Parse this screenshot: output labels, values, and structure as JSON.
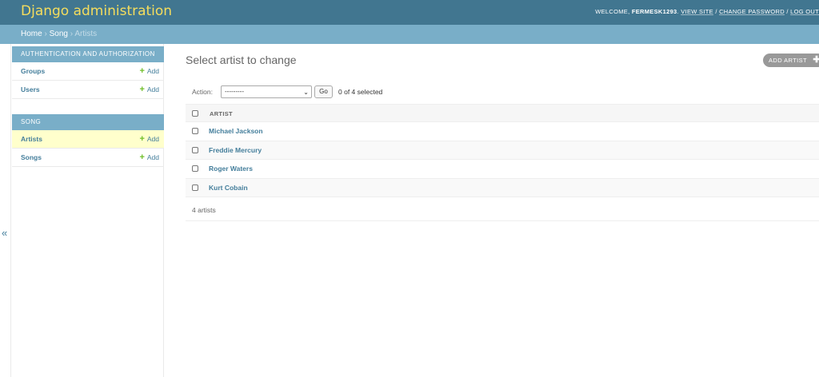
{
  "header": {
    "branding": "Django administration",
    "welcome": "WELCOME,",
    "username": "FERMESK1293",
    "view_site": "VIEW SITE",
    "change_password": "CHANGE PASSWORD",
    "log_out": "LOG OUT",
    "separator": "/"
  },
  "breadcrumbs": {
    "home": "Home",
    "app": "Song",
    "current": "Artists",
    "separator": "›"
  },
  "sidebar": {
    "toggle_glyph": "«",
    "modules": [
      {
        "caption": "AUTHENTICATION AND AUTHORIZATION",
        "models": [
          {
            "name": "Groups",
            "add": "Add"
          },
          {
            "name": "Users",
            "add": "Add"
          }
        ]
      },
      {
        "caption": "SONG",
        "models": [
          {
            "name": "Artists",
            "add": "Add",
            "current": true
          },
          {
            "name": "Songs",
            "add": "Add"
          }
        ]
      }
    ]
  },
  "content": {
    "title": "Select artist to change",
    "add_button": "ADD ARTIST",
    "actions": {
      "label": "Action:",
      "selected_option": "---------",
      "go": "Go",
      "selection_count": "0 of 4 selected"
    },
    "table": {
      "column": "ARTIST",
      "rows": [
        "Michael Jackson",
        "Freddie Mercury",
        "Roger Waters",
        "Kurt Cobain"
      ]
    },
    "paginator": "4 artists"
  },
  "colors": {
    "header_bg": "#417690",
    "branding": "#f5dd5d",
    "breadcrumbs_bg": "#79aec8",
    "link": "#447e9b",
    "add_plus": "#70bf2b",
    "current_row": "#ffffcc"
  }
}
